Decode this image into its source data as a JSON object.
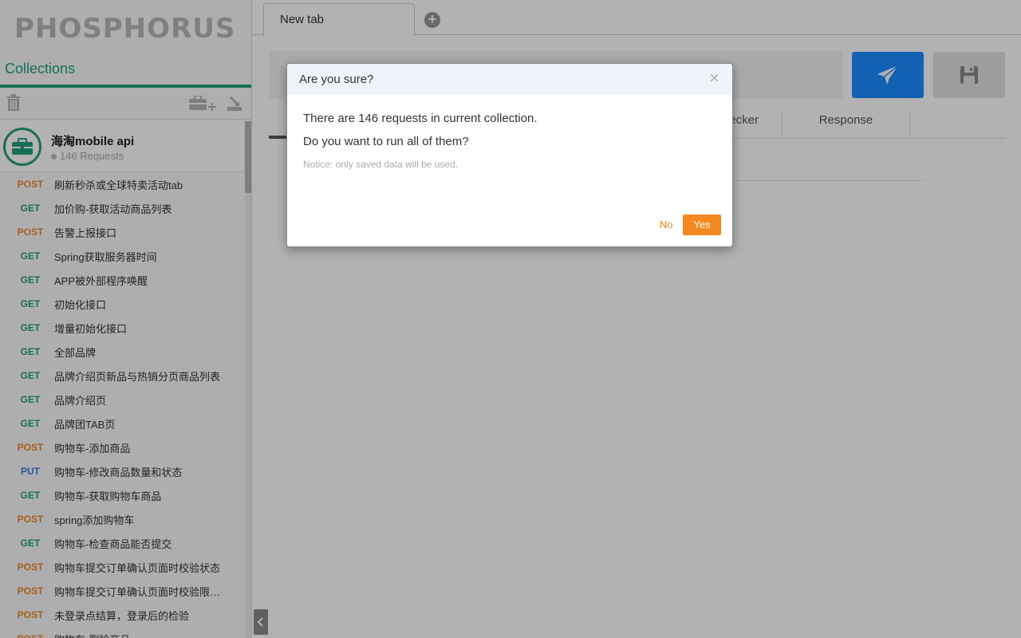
{
  "app": {
    "logo": "PHOSPHORUS"
  },
  "sidebar": {
    "section_title": "Collections",
    "collection": {
      "name": "海淘mobile api",
      "count_label": "146 Requests"
    },
    "requests": [
      {
        "method": "POST",
        "name": "刷新秒杀或全球特卖活动tab"
      },
      {
        "method": "GET",
        "name": "加价购-获取活动商品列表"
      },
      {
        "method": "POST",
        "name": "告警上报接口"
      },
      {
        "method": "GET",
        "name": "Spring获取服务器时间"
      },
      {
        "method": "GET",
        "name": "APP被外部程序唤醒"
      },
      {
        "method": "GET",
        "name": "初始化接口"
      },
      {
        "method": "GET",
        "name": "增量初始化接口"
      },
      {
        "method": "GET",
        "name": "全部品牌"
      },
      {
        "method": "GET",
        "name": "品牌介绍页新品与热销分页商品列表"
      },
      {
        "method": "GET",
        "name": "品牌介绍页"
      },
      {
        "method": "GET",
        "name": "品牌团TAB页"
      },
      {
        "method": "POST",
        "name": "购物车-添加商品"
      },
      {
        "method": "PUT",
        "name": "购物车-修改商品数量和状态"
      },
      {
        "method": "GET",
        "name": "购物车-获取购物车商品"
      },
      {
        "method": "POST",
        "name": "spring添加购物车"
      },
      {
        "method": "GET",
        "name": "购物车-检查商品能否提交"
      },
      {
        "method": "POST",
        "name": "购物车提交订单确认页面时校验状态"
      },
      {
        "method": "POST",
        "name": "购物车提交订单确认页面时校验限购信..."
      },
      {
        "method": "POST",
        "name": "未登录点结算，登录后的检验"
      },
      {
        "method": "POST",
        "name": "购物车-删除商品"
      }
    ]
  },
  "tabs": {
    "new_tab_label": "New tab",
    "add_tab_symbol": "+"
  },
  "sub_tabs": {
    "checker_label": "hecker",
    "response_label": "Response"
  },
  "modal": {
    "title": "Are you sure?",
    "close_symbol": "×",
    "line1": "There are 146 requests in current collection.",
    "line2": "Do you want to run all of them?",
    "notice": "Notice: only saved data will be used.",
    "no_label": "No",
    "yes_label": "Yes"
  },
  "colors": {
    "accent": "#22a07f",
    "post": "#f08a24",
    "get": "#22a07f",
    "put": "#3b7dd8",
    "send": "#1a8cff",
    "yes": "#f5891f"
  }
}
